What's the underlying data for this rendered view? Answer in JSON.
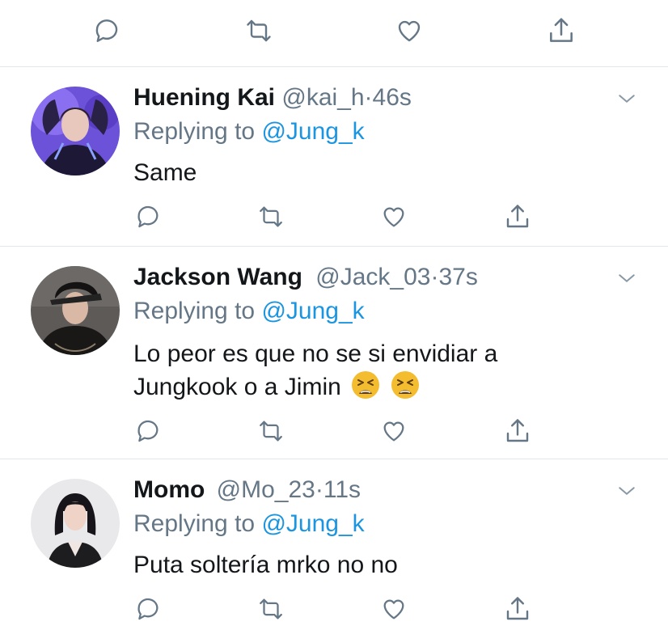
{
  "colors": {
    "accent": "#1b95e0",
    "text": "#14171a",
    "secondary": "#657786",
    "divider": "#e1e8ed"
  },
  "actions": {
    "icons": [
      "reply-icon",
      "retweet-icon",
      "like-icon",
      "share-icon"
    ]
  },
  "tweets": [
    {
      "name": "Huening Kai",
      "handle": "@kai_h",
      "sep": "·",
      "time": "46s",
      "replying_prefix": "Replying to",
      "replying_to": "@Jung_k",
      "lines": [
        "Same"
      ]
    },
    {
      "name": "Jackson Wang",
      "handle": "@Jack_03",
      "sep": "·",
      "time": "37s",
      "replying_prefix": "Replying to",
      "replying_to": "@Jung_k",
      "lines": [
        "Lo peor es que no se si envidiar a",
        "Jungkook o a Jimin"
      ],
      "emojis": [
        "tired-face-emoji",
        "tired-face-emoji"
      ]
    },
    {
      "name": "Momo",
      "handle": "@Mo_23",
      "sep": "·",
      "time": "11s",
      "replying_prefix": "Replying to",
      "replying_to": "@Jung_k",
      "lines": [
        "Puta soltería mrko no no"
      ]
    }
  ]
}
